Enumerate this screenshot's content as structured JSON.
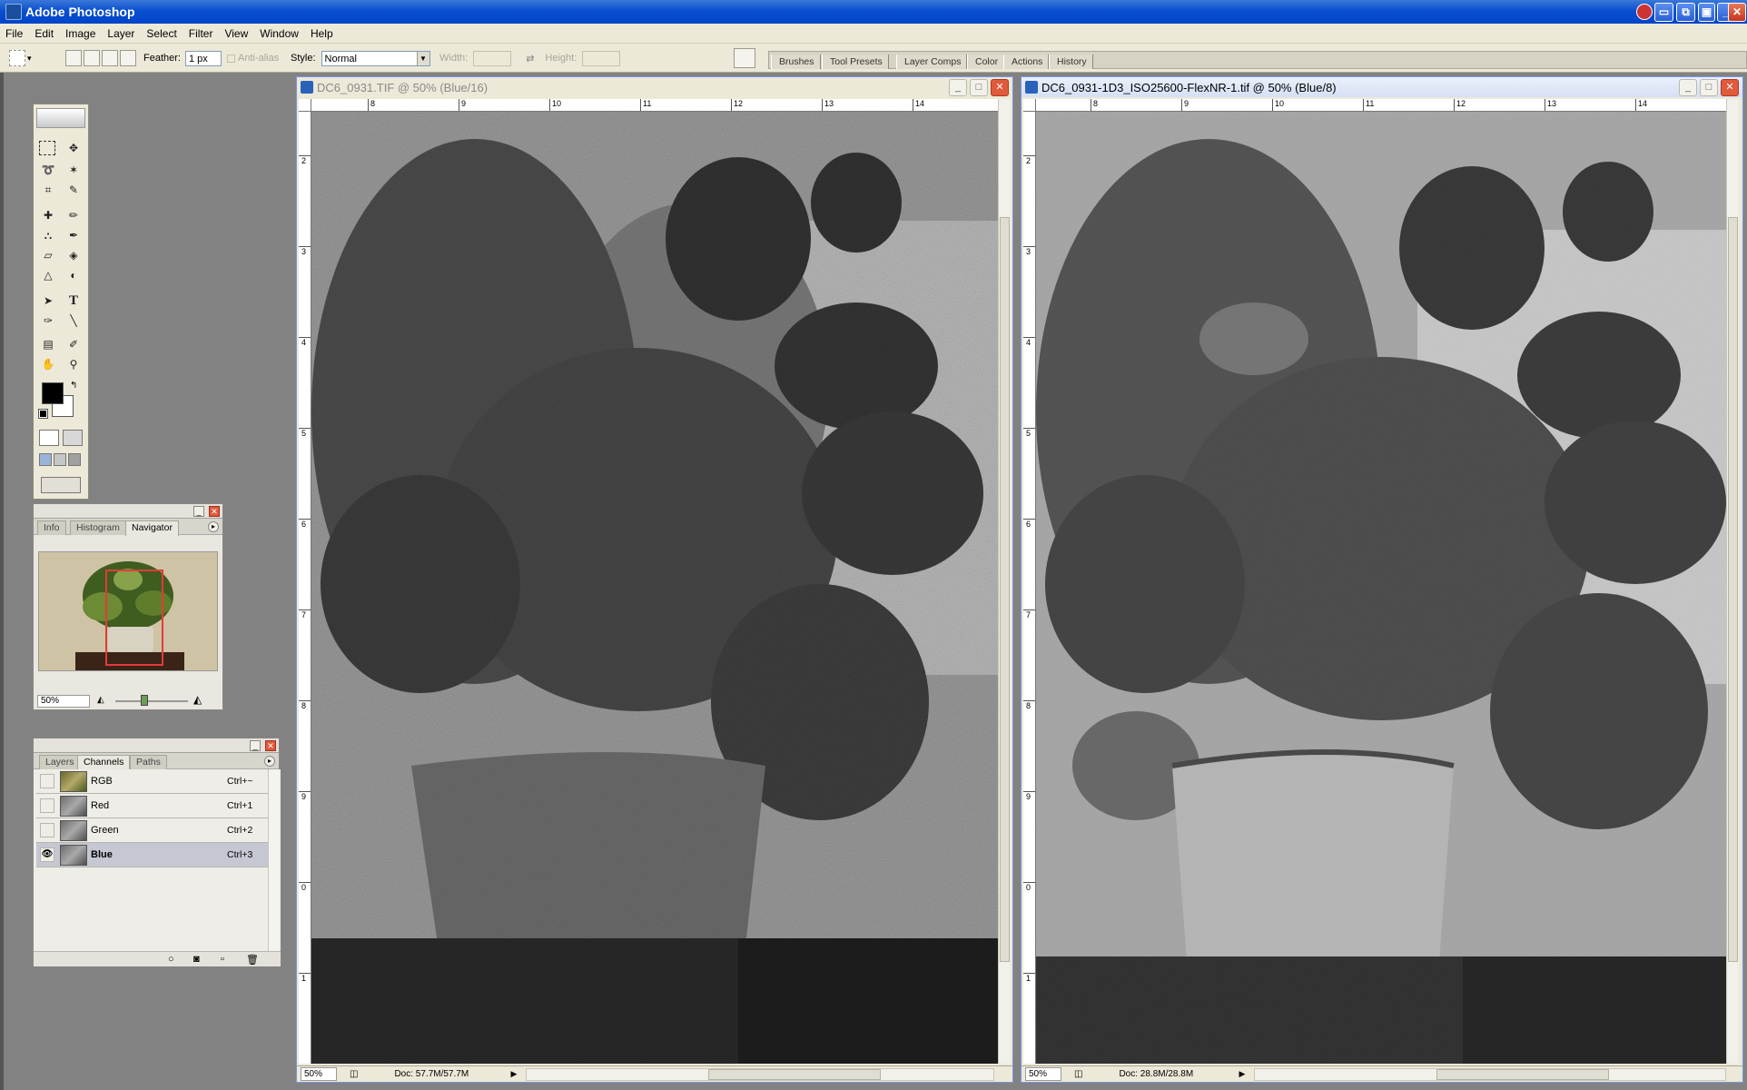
{
  "app": {
    "title": "Adobe Photoshop"
  },
  "menu": [
    "File",
    "Edit",
    "Image",
    "Layer",
    "Select",
    "Filter",
    "View",
    "Window",
    "Help"
  ],
  "options": {
    "feather_label": "Feather:",
    "feather_value": "1 px",
    "antialias_label": "Anti-alias",
    "style_label": "Style:",
    "style_value": "Normal",
    "width_label": "Width:",
    "height_label": "Height:"
  },
  "well_tabs": [
    "Brushes",
    "Tool Presets",
    "Layer Comps",
    "Color",
    "Actions",
    "History"
  ],
  "navigator": {
    "tabs": [
      "Info",
      "Histogram",
      "Navigator"
    ],
    "zoom": "50%"
  },
  "channels": {
    "tabs": [
      "Layers",
      "Channels",
      "Paths"
    ],
    "rows": [
      {
        "name": "RGB",
        "shortcut": "Ctrl+~"
      },
      {
        "name": "Red",
        "shortcut": "Ctrl+1"
      },
      {
        "name": "Green",
        "shortcut": "Ctrl+2"
      },
      {
        "name": "Blue",
        "shortcut": "Ctrl+3"
      }
    ]
  },
  "doc_left": {
    "title": "DC6_0931.TIF @ 50% (Blue/16)",
    "zoom": "50%",
    "doc_size": "Doc: 57.7M/57.7M",
    "ruler_h": [
      "8",
      "9",
      "10",
      "11",
      "12",
      "13",
      "14"
    ],
    "ruler_v": [
      "2",
      "3",
      "4",
      "5",
      "6",
      "7",
      "8",
      "9",
      "0",
      "1"
    ]
  },
  "doc_right": {
    "title": "DC6_0931-1D3_ISO25600-FlexNR-1.tif @ 50% (Blue/8)",
    "zoom": "50%",
    "doc_size": "Doc: 28.8M/28.8M",
    "ruler_h": [
      "8",
      "9",
      "10",
      "11",
      "12",
      "13",
      "14"
    ],
    "ruler_v": [
      "2",
      "3",
      "4",
      "5",
      "6",
      "7",
      "8",
      "9",
      "0",
      "1"
    ]
  },
  "colors": {
    "titlebar": "#0a4fcf",
    "chrome": "#ece9d8",
    "workspace": "#828282",
    "nav_box": "#e23b3b"
  },
  "icons": {
    "close": "close-icon",
    "minimize": "minimize-icon",
    "maximize": "maximize-icon"
  }
}
